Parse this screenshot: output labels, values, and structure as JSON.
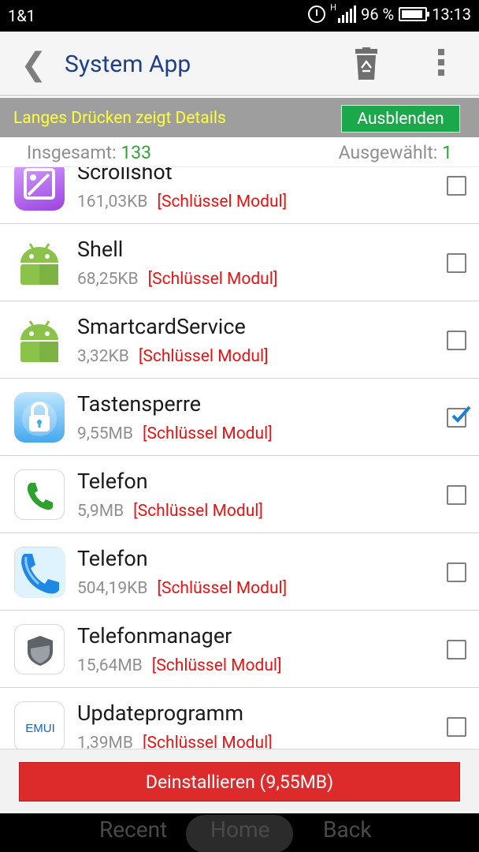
{
  "status_bar": {
    "carrier": "1&1",
    "network": "H",
    "battery_percent": "96 %",
    "time": "13:13"
  },
  "action_bar": {
    "back_icon": "chevron-left-icon",
    "title": "System App",
    "trash_icon": "recycle-trash-icon",
    "overflow_icon": "more-vertical-icon"
  },
  "info_bar": {
    "hint": "Langes Drücken zeigt Details",
    "hide_button": "Ausblenden"
  },
  "counts": {
    "total_label": "Insgesamt:",
    "total_value": "133",
    "selected_label": "Ausgewählt:",
    "selected_value": "1"
  },
  "apps": [
    {
      "name": "Scrollshot",
      "size": "161,03KB",
      "tag": "[Schlüssel Modul]",
      "icon": "scrollshot-icon",
      "checked": false
    },
    {
      "name": "Shell",
      "size": "68,25KB",
      "tag": "[Schlüssel Modul]",
      "icon": "android-icon",
      "checked": false
    },
    {
      "name": "SmartcardService",
      "size": "3,32KB",
      "tag": "[Schlüssel Modul]",
      "icon": "android-icon",
      "checked": false
    },
    {
      "name": "Tastensperre",
      "size": "9,55MB",
      "tag": "[Schlüssel Modul]",
      "icon": "lock-icon",
      "checked": true
    },
    {
      "name": "Telefon",
      "size": "5,9MB",
      "tag": "[Schlüssel Modul]",
      "icon": "phone-icon",
      "checked": false
    },
    {
      "name": "Telefon",
      "size": "504,19KB",
      "tag": "[Schlüssel Modul]",
      "icon": "phone-blue-icon",
      "checked": false
    },
    {
      "name": "Telefonmanager",
      "size": "15,64MB",
      "tag": "[Schlüssel Modul]",
      "icon": "shield-icon",
      "checked": false
    },
    {
      "name": "Updateprogramm",
      "size": "1,39MB",
      "tag": "[Schlüssel Modul]",
      "icon": "emui-icon",
      "checked": false
    }
  ],
  "emui_logo_text": "EMUI",
  "uninstall_button": "Deinstallieren (9,55MB)",
  "nav_bar": {
    "recent": "Recent",
    "home": "Home",
    "back": "Back"
  },
  "colors": {
    "title_blue": "#1f3f88",
    "hint_yellow": "#ffff33",
    "hide_green": "#1aa84a",
    "count_green": "#31a43a",
    "tag_red": "#ee1111",
    "uninstall_red": "#dd2a2a",
    "check_blue": "#1b7fd1"
  }
}
